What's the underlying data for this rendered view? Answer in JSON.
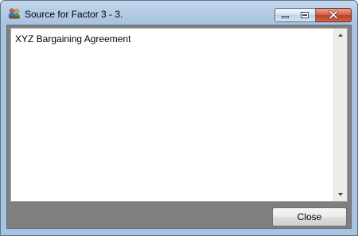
{
  "window": {
    "title": "Source for Factor 3 - 3."
  },
  "textarea": {
    "value": "XYZ Bargaining Agreement"
  },
  "footer": {
    "close_label": "Close"
  },
  "icons": {
    "app": "people-group-icon",
    "minimize": "minimize-icon",
    "maximize": "maximize-icon",
    "close": "close-icon",
    "scroll_up": "scroll-up-arrow-icon",
    "scroll_down": "scroll-down-arrow-icon"
  },
  "colors": {
    "titlebar": "#b9cfe7",
    "close_button": "#c13f23",
    "client_background": "#7f7f7f"
  }
}
